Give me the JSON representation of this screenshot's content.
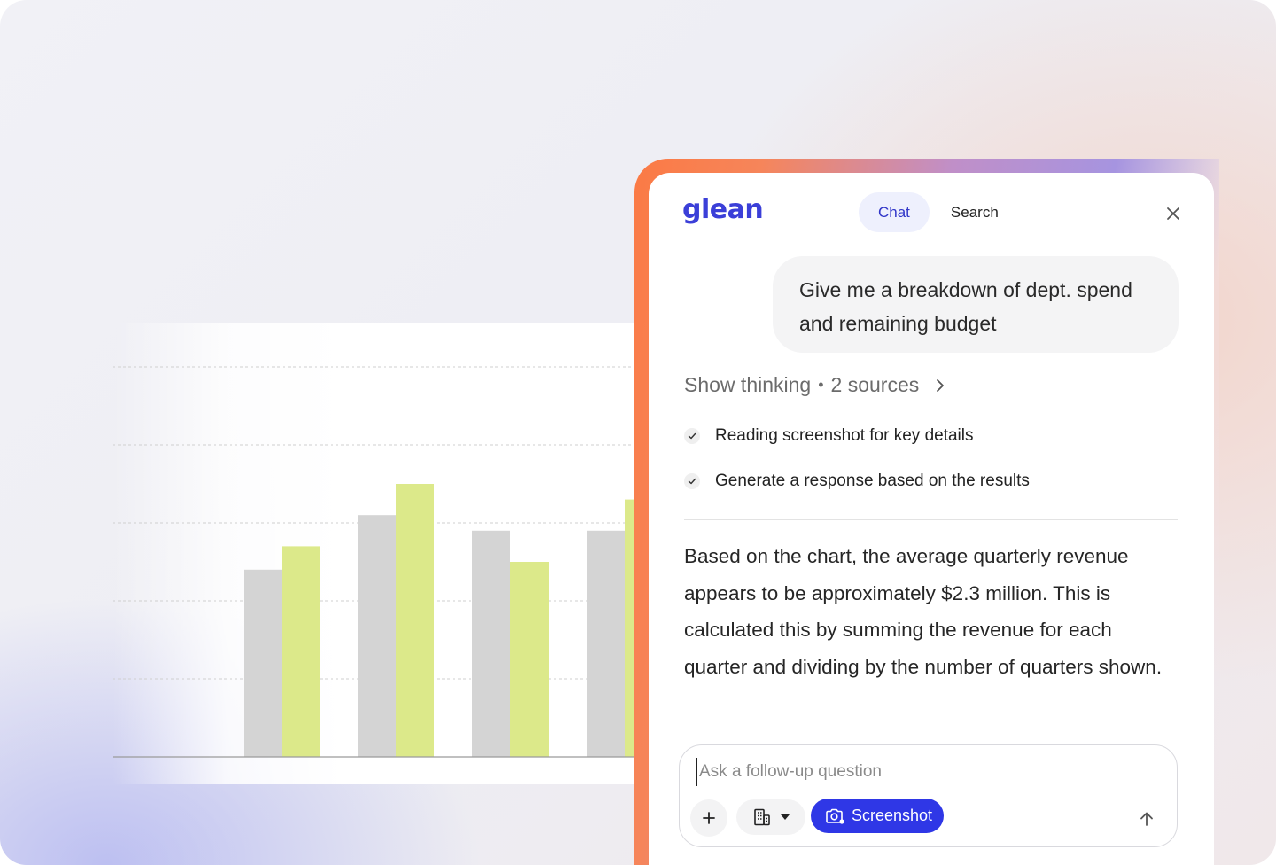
{
  "chart_data": {
    "type": "bar",
    "title": "",
    "categories": [
      "",
      "",
      "",
      ""
    ],
    "series": [
      {
        "values": [
          24,
          31,
          29,
          29
        ],
        "color": "#d4d4d4"
      },
      {
        "values": [
          27,
          35,
          25,
          33
        ],
        "color": "#dce98a"
      }
    ],
    "ylim": [
      0,
      50
    ],
    "grid": true,
    "legend": "none"
  },
  "panel": {
    "logo": "glean",
    "tabs": [
      {
        "label": "Chat",
        "active": true
      },
      {
        "label": "Search",
        "active": false
      }
    ],
    "close_icon": "close-icon"
  },
  "conversation": {
    "user_message": "Give me a breakdown of dept. spend and remaining budget",
    "thinking_label": "Show thinking",
    "separator": "•",
    "sources_label": "2 sources",
    "steps": [
      "Reading screenshot for key details",
      "Generate a response based on the results"
    ],
    "answer": "Based on the chart, the average quarterly revenue appears to be approximately $2.3 million. This is calculated this by summing the revenue for each quarter and dividing by the number of quarters shown."
  },
  "composer": {
    "placeholder": "Ask a follow-up question",
    "value": "",
    "screenshot_label": "Screenshot",
    "icons": [
      "plus-icon",
      "building-icon",
      "caret-down-icon",
      "camera-icon",
      "arrow-up-icon"
    ]
  },
  "colors": {
    "accent": "#2f37e6",
    "logo": "#3b3fd8",
    "tab_active_bg": "#eef0fd",
    "bar_gray": "#d4d4d4",
    "bar_green": "#dce98a"
  }
}
